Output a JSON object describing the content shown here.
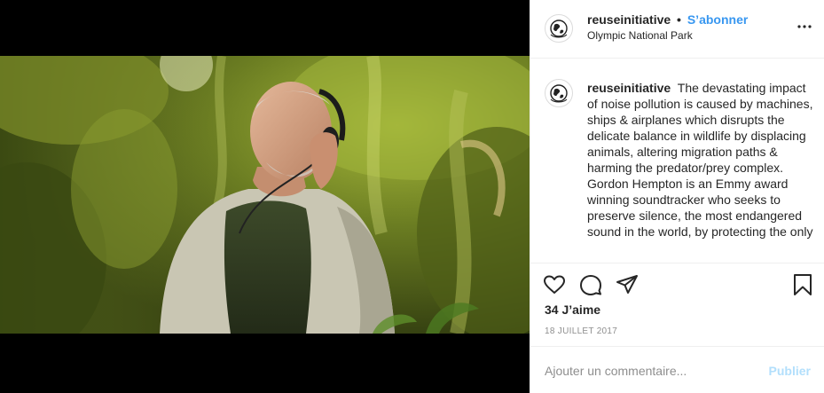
{
  "post": {
    "username": "reuseinitiative",
    "separator": "•",
    "follow_label": "S’abonner",
    "location": "Olympic National Park",
    "caption_text": "The devastating impact of noise pollution is caused by machines, ships & airplanes which disrupts the delicate balance in wildlife by displacing animals, altering migration paths & harming the predator/prey complex. Gordon Hempton is an Emmy award winning soundtracker who seeks to preserve silence, the most endangered sound in the world, by protecting the only",
    "likes": "34 J’aime",
    "date": "18 JUILLET 2017"
  },
  "comment_box": {
    "placeholder": "Ajouter un commentaire...",
    "publish_label": "Publier"
  },
  "icons": {
    "avatar": "globe-logo-icon",
    "more": "more-options-icon",
    "like": "heart-icon",
    "comment": "comment-bubble-icon",
    "share": "paper-plane-icon",
    "save": "bookmark-icon"
  },
  "colors": {
    "follow": "#3897f0",
    "publish_disabled": "#b2dffc",
    "muted_text": "#8e8e8e",
    "border": "#efefef"
  }
}
